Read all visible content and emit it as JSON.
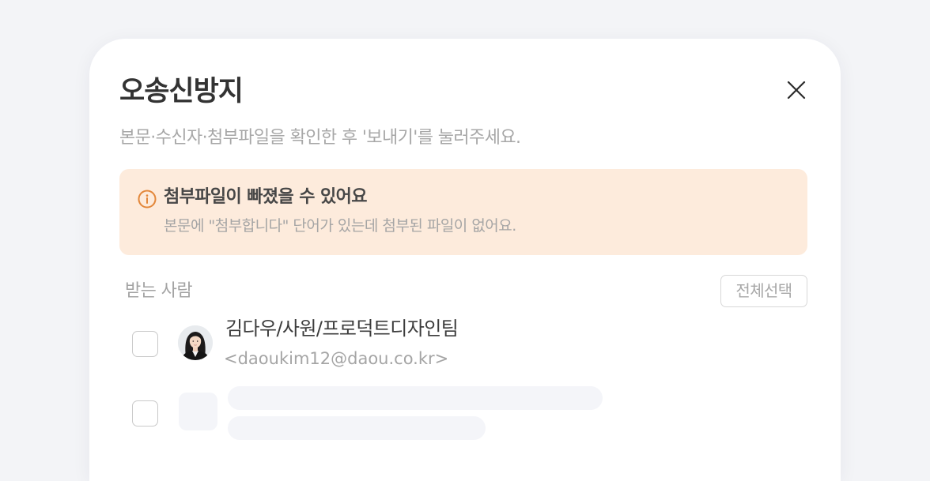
{
  "modal": {
    "title": "오송신방지",
    "close_icon": "close-icon",
    "subtitle": "본문·수신자·첨부파일을 확인한 후 '보내기'를 눌러주세요."
  },
  "alert": {
    "icon": "info-icon",
    "title": "첨부파일이 빠졌을 수 있어요",
    "description": "본문에 \"첨부합니다\" 단어가 있는데 첨부된 파일이 없어요.",
    "colors": {
      "background": "#fdebdc",
      "icon": "#e3873a"
    }
  },
  "recipients": {
    "label": "받는 사람",
    "select_all_label": "전체선택",
    "items": [
      {
        "name": "김다우/사원/프로덕트디자인팀",
        "email": "<daoukim12@daou.co.kr>",
        "checked": false,
        "avatar": "avatar-photo"
      },
      {
        "loading": true,
        "checked": false
      }
    ]
  }
}
